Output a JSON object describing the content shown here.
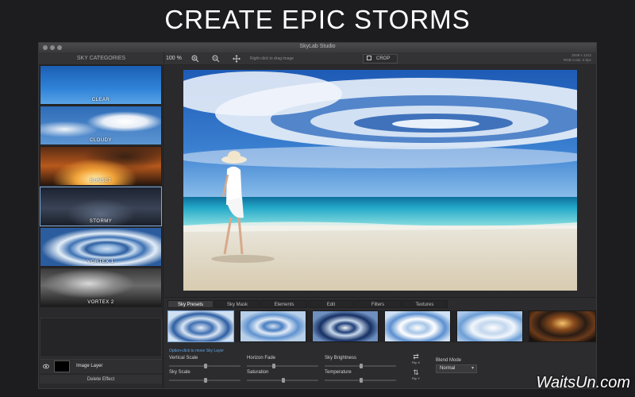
{
  "headline": "CREATE EPIC STORMS",
  "window": {
    "title": "SkyLab Studio"
  },
  "toolbar": {
    "sky_categories_label": "SKY CATEGORIES",
    "zoom": "100 %",
    "hint": "Right-click to drag image",
    "crop_label": "CROP",
    "image_size": "2048 x 1312",
    "color_info": "RGB Color, 8 bpc"
  },
  "sky_categories": [
    {
      "label": "CLEAR"
    },
    {
      "label": "CLOUDY"
    },
    {
      "label": "SUNSET"
    },
    {
      "label": "STORMY"
    },
    {
      "label": "VORTEX 1"
    },
    {
      "label": "VORTEX 2"
    }
  ],
  "layer": {
    "name": "Image Layer",
    "delete_label": "Delete Effect"
  },
  "tabs": [
    "Sky Presets",
    "Sky Mask",
    "Elements",
    "Edit",
    "Filters",
    "Textures"
  ],
  "controls": {
    "hint": "Option-click to move Sky Layer",
    "vertical_scale": "Vertical Scale",
    "sky_scale": "Sky Scale",
    "horizon_fade": "Horizon Fade",
    "saturation": "Saturation",
    "sky_brightness": "Sky Brightness",
    "temperature": "Temperature",
    "flip_x": "Flip X",
    "flip_y": "Flip Y",
    "blend_mode_label": "Blend Mode",
    "blend_mode_value": "Normal"
  },
  "watermark": "WaitsUn.com"
}
